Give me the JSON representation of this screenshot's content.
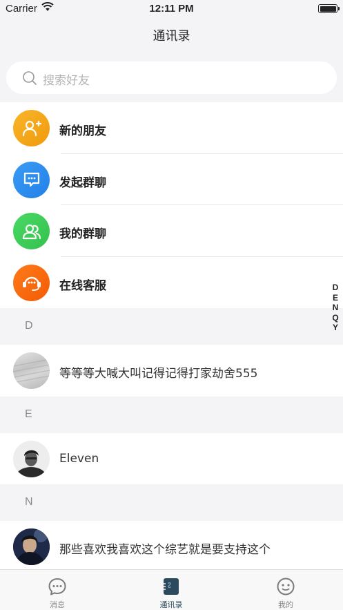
{
  "status_bar": {
    "carrier": "Carrier",
    "time": "12:11 PM"
  },
  "nav": {
    "title": "通讯录"
  },
  "search": {
    "placeholder": "搜索好友"
  },
  "menu": [
    {
      "label": "新的朋友",
      "icon": "add-friend-icon",
      "color": "#f5a516"
    },
    {
      "label": "发起群聊",
      "icon": "chat-bubble-icon",
      "color": "#2e8ef0"
    },
    {
      "label": "我的群聊",
      "icon": "group-icon",
      "color": "#3fcd5a"
    },
    {
      "label": "在线客服",
      "icon": "headset-icon",
      "color": "#fb6a10"
    }
  ],
  "sections": [
    {
      "letter": "D",
      "contacts": [
        {
          "name": "等等等大喊大叫记得记得打家劫舍555"
        }
      ]
    },
    {
      "letter": "E",
      "contacts": [
        {
          "name": "Eleven"
        }
      ]
    },
    {
      "letter": "N",
      "contacts": [
        {
          "name": "那些喜欢我喜欢这个综艺就是要支持这个"
        }
      ]
    }
  ],
  "index_letters": [
    "D",
    "E",
    "N",
    "Q",
    "Y"
  ],
  "tabs": [
    {
      "label": "消息",
      "icon": "message-icon",
      "active": false
    },
    {
      "label": "通讯录",
      "icon": "contacts-icon",
      "active": true
    },
    {
      "label": "我的",
      "icon": "profile-icon",
      "active": false
    }
  ]
}
